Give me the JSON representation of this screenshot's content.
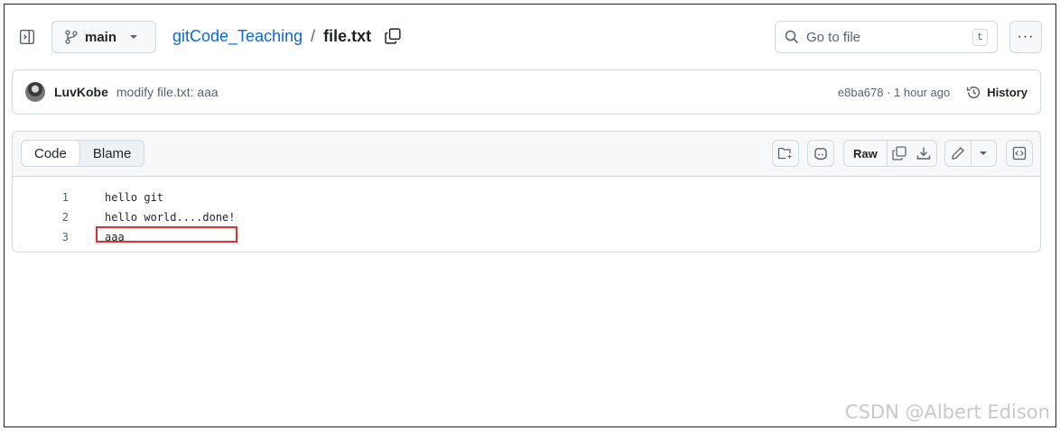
{
  "header": {
    "branch": "main",
    "repo": "gitCode_Teaching",
    "separator": "/",
    "file": "file.txt",
    "search_placeholder": "Go to file",
    "search_shortcut": "t",
    "more_label": "···"
  },
  "commit": {
    "author": "LuvKobe",
    "message": "modify file.txt: aaa",
    "meta": "e8ba678 · 1 hour ago",
    "history_label": "History"
  },
  "file_view": {
    "tabs": [
      {
        "label": "Code",
        "active": true
      },
      {
        "label": "Blame",
        "active": false
      }
    ],
    "raw_label": "Raw",
    "lines": [
      {
        "number": "1",
        "text": "hello git"
      },
      {
        "number": "2",
        "text": "hello world....done!"
      },
      {
        "number": "3",
        "text": "aaa"
      }
    ]
  },
  "colors": {
    "link": "#0969da",
    "highlight": "#e0312e",
    "border": "#d1d9e0"
  },
  "watermark": "CSDN @Albert Edison"
}
